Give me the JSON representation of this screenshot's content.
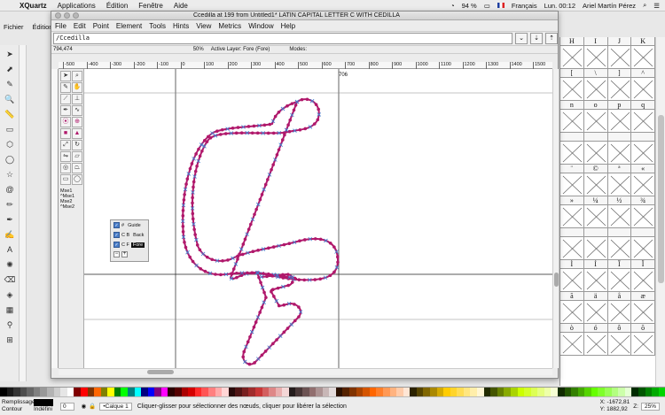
{
  "macbar": {
    "app": "XQuartz",
    "menus": [
      "Applications",
      "Édition",
      "Fenêtre",
      "Aide"
    ],
    "battery": "94 %",
    "keyboard": "Français",
    "clock": "Lun. 00:12",
    "user": "Ariel Martín Pérez"
  },
  "bg_window": {
    "menus": [
      "Fichier",
      "Édition"
    ]
  },
  "window": {
    "title": "Ccedilla at 199 from Untitled1* LATIN CAPITAL LETTER C WITH CEDILLA",
    "menus": [
      "File",
      "Edit",
      "Point",
      "Element",
      "Tools",
      "Hints",
      "View",
      "Metrics",
      "Window",
      "Help"
    ],
    "command_value": "/Ccedilla",
    "info": {
      "coords": "794,474",
      "zoom": "50%",
      "active_layer": "Active Layer: Fore (Fore)",
      "modes": "Modes:"
    },
    "ruler_ticks": [
      "-500",
      "-400",
      "-300",
      "-200",
      "-100",
      "0",
      "100",
      "200",
      "300",
      "400",
      "500",
      "600",
      "700",
      "800",
      "900",
      "1000",
      "1100",
      "1200",
      "1300",
      "1400",
      "1500"
    ],
    "width_label": "706",
    "mouse_labels": [
      "Mse1",
      "^Mse1",
      "Mse2",
      "^Mse2"
    ],
    "layers": [
      {
        "code": "#",
        "name": "Guide"
      },
      {
        "code": "C B",
        "name": "Back"
      },
      {
        "code": "C F",
        "name": "Fore"
      }
    ]
  },
  "fontview": {
    "rows": [
      [
        "H",
        "I",
        "J",
        "K"
      ],
      [
        "[",
        "\\",
        "]",
        "^"
      ],
      [
        "n",
        "o",
        "p",
        "q"
      ],
      [
        "",
        "",
        "",
        ""
      ],
      [
        "¨",
        "©",
        "ª",
        "«"
      ],
      [
        "»",
        "¼",
        "½",
        "¾"
      ],
      [
        "",
        "",
        "",
        ""
      ],
      [
        "Ì",
        "Í",
        "Î",
        "Ï"
      ],
      [
        "ã",
        "ä",
        "å",
        "æ"
      ],
      [
        "ò",
        "ó",
        "ô",
        "õ"
      ]
    ]
  },
  "status": {
    "fill_label": "Remplissage",
    "stroke_label": "Contour",
    "stroke_value": "Indéfini",
    "opacity": "0",
    "layer": "•Calque 1",
    "message": "Cliquer-glisser pour sélectionner des nœuds, cliquer pour libérer la sélection",
    "x": "X: -1672,81",
    "y": "Y: 1882,92",
    "zoom": "25%"
  },
  "colors": {
    "glyph_stroke": "#b0186b",
    "control_point": "#3f7fd0"
  }
}
